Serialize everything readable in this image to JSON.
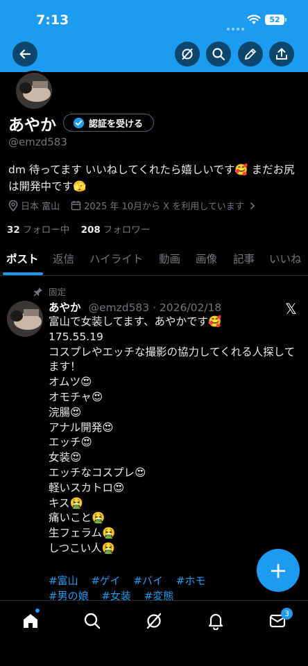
{
  "status_bar": {
    "time": "7:13",
    "battery": "52"
  },
  "header": {
    "back": "back-arrow-icon",
    "actions": [
      "grok-icon",
      "search-icon",
      "pencil-icon",
      "share-icon"
    ]
  },
  "profile": {
    "name": "あやか",
    "verify_label": "認証を受ける",
    "handle": "@emzd583",
    "bio": "dm 待ってます いいねしてくれたら嬉しいです🥰 まだお尻は開発中です🫣",
    "location": "日本 富山",
    "joined": "2025 年 10月から X を利用しています",
    "following_count": "32",
    "following_label": "フォロー中",
    "followers_count": "208",
    "followers_label": "フォロワー"
  },
  "tabs": [
    "ポスト",
    "返信",
    "ハイライト",
    "動画",
    "画像",
    "記事",
    "いいね"
  ],
  "post": {
    "pinned_label": "固定",
    "author": "あやか",
    "handle_date": "@emzd583 · 2026/02/18",
    "lines": [
      "富山で女装してます、あやかです🥰",
      "175.55.19",
      "コスプレやエッチな撮影の協力してくれる人探してます！",
      "オムツ😍",
      "オモチャ😍",
      "浣腸😍",
      "アナル開発😍",
      "エッチ😍",
      "女装😍",
      "エッチなコスプレ😍",
      "軽いスカトロ😍",
      "キス🤮",
      "痛いこと🤮",
      "生フェラム🤮",
      "しつこい人🤮"
    ],
    "hashtags_row1": [
      "#富山",
      "#ゲイ",
      "#バイ",
      "#ホモ"
    ],
    "hashtags_row2": [
      "#男の娘",
      "#女装",
      "#変態"
    ]
  },
  "fab_label": "+",
  "bottom_nav": {
    "items": [
      "home-icon",
      "search-icon",
      "grok-icon",
      "notifications-icon",
      "messages-icon"
    ],
    "messages_badge": "3"
  },
  "colors": {
    "accent": "#1d9bf0",
    "background": "#000000",
    "muted": "#71767b"
  }
}
